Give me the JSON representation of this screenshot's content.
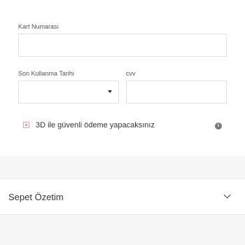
{
  "card_form": {
    "card_number_label": "Kart Numarası",
    "card_number_value": "",
    "expiry_label": "Son Kullanma Tarihi",
    "expiry_value": "",
    "cvv_label": "cvv",
    "cvv_value": "",
    "secure_3d_label": "3D ile güvenli ödeme yapacaksınız",
    "secure_3d_checked": false,
    "info_icon": "info-icon",
    "dropdown_icon": "caret-down-icon"
  },
  "summary": {
    "title": "Sepet Özetim",
    "toggle_icon": "chevron-down-icon"
  },
  "colors": {
    "checkbox_accent": "#e99aa8",
    "background": "#f7f7f7",
    "panel": "#ffffff"
  }
}
